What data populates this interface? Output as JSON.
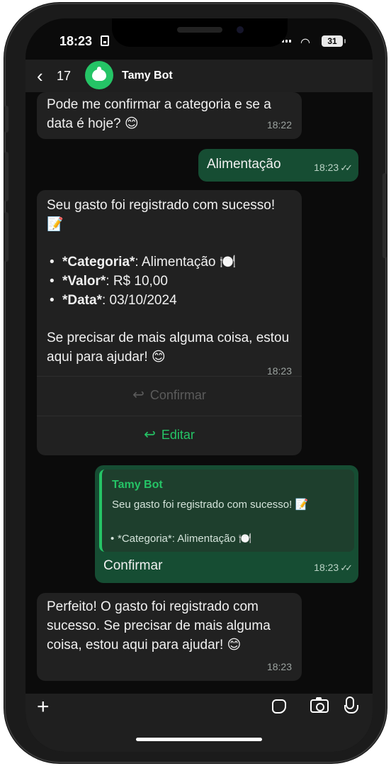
{
  "status": {
    "time": "18:23",
    "battery": "31"
  },
  "header": {
    "back_count": "17",
    "contact_name": "Tamy Bot"
  },
  "messages": {
    "m1": {
      "text": "Pode me confirmar a categoria e se a data é hoje? 😊",
      "time": "18:22"
    },
    "m2": {
      "text": "Alimentação",
      "time": "18:23"
    },
    "m3": {
      "intro": "Seu gasto foi registrado com sucesso! 📝",
      "items": [
        {
          "key": "*Categoria*",
          "value": ": Alimentação 🍽️"
        },
        {
          "key": "*Valor*",
          "value": ": R$ 10,00"
        },
        {
          "key": "*Data*",
          "value": ": 03/10/2024"
        }
      ],
      "outro": "Se precisar de mais alguma coisa, estou aqui para ajudar! 😊",
      "time": "18:23",
      "confirm_label": "Confirmar",
      "edit_label": "Editar"
    },
    "m4": {
      "quote_name": "Tamy Bot",
      "quote_line1": "Seu gasto foi registrado com sucesso! 📝",
      "quote_line2": "*Categoria*: Alimentação 🍽️",
      "text": "Confirmar",
      "time": "18:23"
    },
    "m5": {
      "text": "Perfeito! O gasto foi registrado com sucesso. Se precisar de mais alguma coisa, estou aqui para ajudar! 😊",
      "time": "18:23"
    }
  },
  "colors": {
    "accent": "#25c466",
    "outgoing": "#164d33",
    "incoming": "#212121"
  }
}
